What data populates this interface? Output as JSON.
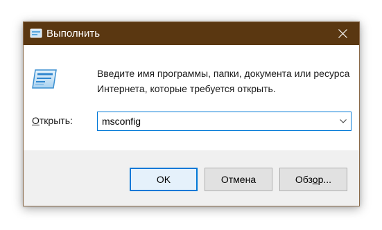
{
  "window": {
    "title": "Выполнить",
    "titlebar_color": "#5a3711",
    "close_icon": "close-icon"
  },
  "main": {
    "description": "Введите имя программы, папки, документа или ресурса Интернета, которые требуется открыть.",
    "open_label_underlined": "О",
    "open_label_rest": "ткрыть:",
    "input_value": "msconfig",
    "dropdown_icon": "chevron-down-icon",
    "program_icon": "run-icon"
  },
  "buttons": {
    "ok_label": "OK",
    "cancel_label": "Отмена",
    "browse_label_pre": "Обз",
    "browse_label_underlined": "о",
    "browse_label_post": "р..."
  },
  "colors": {
    "accent": "#0078d7",
    "footer_bg": "#f0f0f0"
  }
}
